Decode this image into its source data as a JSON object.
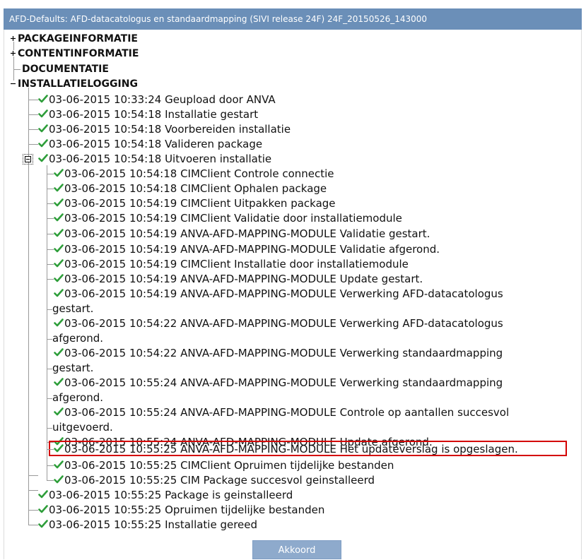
{
  "window": {
    "title": "AFD-Defaults: AFD-datacatologus en standaardmapping (SIVI release 24F) 24F_20150526_143000"
  },
  "tree": {
    "sections": [
      {
        "label": "PACKAGEINFORMATIE",
        "state": "collapsed"
      },
      {
        "label": "CONTENTINFORMATIE",
        "state": "collapsed"
      },
      {
        "label": "DOCUMENTATIE",
        "state": "leaf"
      },
      {
        "label": "INSTALLATIELOGGING",
        "state": "expanded"
      }
    ],
    "log": [
      {
        "text": "03-06-2015 10:33:24 Geupload door ANVA"
      },
      {
        "text": "03-06-2015 10:54:18 Installatie gestart"
      },
      {
        "text": "03-06-2015 10:54:18 Voorbereiden installatie"
      },
      {
        "text": "03-06-2015 10:54:18 Valideren package"
      },
      {
        "text": "03-06-2015 10:54:18 Uitvoeren installatie",
        "state": "expanded"
      },
      {
        "text": "03-06-2015 10:54:18 CIMClient Controle connectie"
      },
      {
        "text": "03-06-2015 10:54:18 CIMClient Ophalen package"
      },
      {
        "text": "03-06-2015 10:54:19 CIMClient Uitpakken package"
      },
      {
        "text": "03-06-2015 10:54:19 CIMClient Validatie door installatiemodule"
      },
      {
        "text": "03-06-2015 10:54:19 ANVA-AFD-MAPPING-MODULE Validatie gestart."
      },
      {
        "text": "03-06-2015 10:54:19 ANVA-AFD-MAPPING-MODULE Validatie afgerond."
      },
      {
        "text": "03-06-2015 10:54:19 CIMClient Installatie door installatiemodule"
      },
      {
        "text": "03-06-2015 10:54:19 ANVA-AFD-MAPPING-MODULE Update gestart."
      },
      {
        "text": "03-06-2015 10:54:19 ANVA-AFD-MAPPING-MODULE Verwerking AFD-datacatologus",
        "cont": "gestart."
      },
      {
        "text": "03-06-2015 10:54:22 ANVA-AFD-MAPPING-MODULE Verwerking AFD-datacatologus",
        "cont": "afgerond."
      },
      {
        "text": "03-06-2015 10:54:22 ANVA-AFD-MAPPING-MODULE Verwerking standaardmapping",
        "cont": "gestart."
      },
      {
        "text": "03-06-2015 10:55:24 ANVA-AFD-MAPPING-MODULE Verwerking standaardmapping",
        "cont": "afgerond."
      },
      {
        "text": "03-06-2015 10:55:24 ANVA-AFD-MAPPING-MODULE Controle op aantallen succesvol",
        "cont": "uitgevoerd."
      },
      {
        "text": "03-06-2015 10:55:24 ANVA-AFD-MAPPING-MODULE Update afgerond."
      },
      {
        "text": "03-06-2015 10:55:25 ANVA-AFD-MAPPING-MODULE Het updateverslag is opgeslagen.",
        "highlighted": true
      },
      {
        "text": "03-06-2015 10:55:25 CIMClient Opruimen tijdelijke bestanden"
      },
      {
        "text": "03-06-2015 10:55:25 CIM Package succesvol geinstalleerd"
      },
      {
        "text": "03-06-2015 10:55:25 Package is geinstalleerd"
      },
      {
        "text": "03-06-2015 10:55:25 Opruimen tijdelijke bestanden"
      },
      {
        "text": "03-06-2015 10:55:25 Installatie gereed"
      }
    ]
  },
  "buttons": {
    "ok_label": "Akkoord"
  },
  "colors": {
    "titlebar": "#6b8fb8",
    "button": "#8eaacc",
    "check": "#2e9e3a",
    "highlight_border": "#d40000"
  },
  "icons": {
    "check": "check-icon",
    "expand": "plus-icon",
    "collapse": "minus-icon"
  }
}
